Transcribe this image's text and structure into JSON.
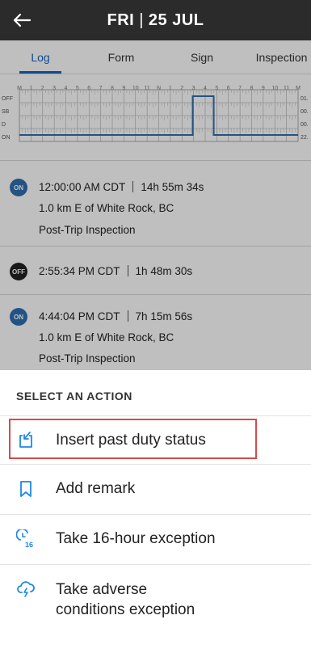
{
  "header": {
    "day": "FRI",
    "date": "25 JUL"
  },
  "tabs": [
    {
      "label": "Log",
      "active": true
    },
    {
      "label": "Form",
      "active": false
    },
    {
      "label": "Sign",
      "active": false
    },
    {
      "label": "Inspection",
      "active": false
    }
  ],
  "graph": {
    "hour_labels": [
      "M",
      "1",
      "2",
      "3",
      "4",
      "5",
      "6",
      "7",
      "8",
      "9",
      "10",
      "11",
      "N",
      "1",
      "2",
      "3",
      "4",
      "5",
      "6",
      "7",
      "8",
      "9",
      "10",
      "11",
      "M"
    ],
    "rows": [
      "OFF",
      "SB",
      "D",
      "ON"
    ],
    "totals": [
      "01.",
      "00.",
      "00.",
      "22."
    ],
    "line_color": "#2f6fb0"
  },
  "events": [
    {
      "badge": "ON",
      "time": "12:00:00 AM CDT",
      "duration": "14h 55m 34s",
      "location": "1.0 km E of White Rock, BC",
      "note": "Post-Trip Inspection"
    },
    {
      "badge": "OFF",
      "time": "2:55:34 PM CDT",
      "duration": "1h 48m 30s"
    },
    {
      "badge": "ON",
      "time": "4:44:04 PM CDT",
      "duration": "7h 15m 56s",
      "location": "1.0 km E of White Rock, BC",
      "note": "Post-Trip Inspection"
    }
  ],
  "sheet": {
    "title": "SELECT AN ACTION",
    "actions": [
      {
        "label": "Insert past duty status",
        "icon": "insert-duty-status-icon"
      },
      {
        "label": "Add remark",
        "icon": "bookmark-icon"
      },
      {
        "label": "Take 16-hour exception",
        "icon": "clock-16-icon",
        "icon_text": "16"
      },
      {
        "label_line1": "Take adverse",
        "label_line2": "conditions exception",
        "icon": "storm-cloud-icon"
      }
    ],
    "accent_color": "#1e88e5",
    "highlight_color": "#d84a4a"
  }
}
